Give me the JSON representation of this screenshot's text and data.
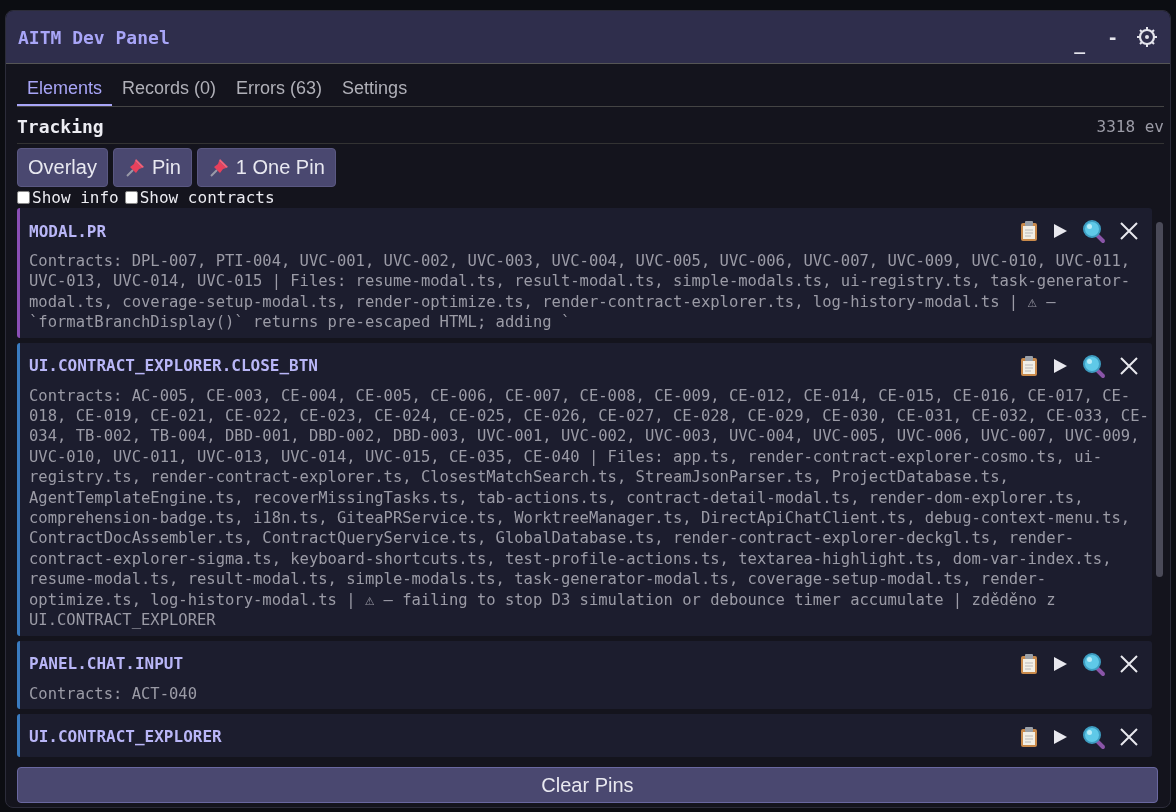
{
  "window": {
    "title": "AITM Dev Panel",
    "controls": [
      "_",
      "-"
    ]
  },
  "tabs": [
    {
      "label": "Elements",
      "selected": true
    },
    {
      "label": "Records (0)",
      "selected": false
    },
    {
      "label": "Errors (63)",
      "selected": false
    },
    {
      "label": "Settings",
      "selected": false
    }
  ],
  "tracking": {
    "label": "Tracking",
    "count": "3318 ev"
  },
  "buttons": [
    {
      "label": "Overlay",
      "kind": "plain"
    },
    {
      "label": "Pin",
      "kind": "pin"
    },
    {
      "label": "1 One Pin",
      "kind": "pin"
    }
  ],
  "checkboxes": [
    {
      "label": "Show info",
      "checked": false
    },
    {
      "label": "Show contracts",
      "checked": false
    }
  ],
  "pins": [
    {
      "name": "MODAL.PR",
      "color": "#8a4fb5",
      "details": "Contracts: DPL-007, PTI-004, UVC-001, UVC-002, UVC-003, UVC-004, UVC-005, UVC-006, UVC-007, UVC-009, UVC-010, UVC-011, UVC-013, UVC-014, UVC-015 | Files: resume-modal.ts, result-modal.ts, simple-modals.ts, ui-registry.ts, task-generator-modal.ts, coverage-setup-modal.ts, render-optimize.ts, render-contract-explorer.ts, log-history-modal.ts | ⚠ — `formatBranchDisplay()` returns pre-escaped HTML; adding `"
    },
    {
      "name": "UI.CONTRACT_EXPLORER.CLOSE_BTN",
      "color": "#3a7bbf",
      "details": "Contracts: AC-005, CE-003, CE-004, CE-005, CE-006, CE-007, CE-008, CE-009, CE-012, CE-014, CE-015, CE-016, CE-017, CE-018, CE-019, CE-021, CE-022, CE-023, CE-024, CE-025, CE-026, CE-027, CE-028, CE-029, CE-030, CE-031, CE-032, CE-033, CE-034, TB-002, TB-004, DBD-001, DBD-002, DBD-003, UVC-001, UVC-002, UVC-003, UVC-004, UVC-005, UVC-006, UVC-007, UVC-009, UVC-010, UVC-011, UVC-013, UVC-014, UVC-015, CE-035, CE-040 | Files: app.ts, render-contract-explorer-cosmo.ts, ui-registry.ts, render-contract-explorer.ts, ClosestMatchSearch.ts, StreamJsonParser.ts, ProjectDatabase.ts, AgentTemplateEngine.ts, recoverMissingTasks.ts, tab-actions.ts, contract-detail-modal.ts, render-dom-explorer.ts, comprehension-badge.ts, i18n.ts, GiteaPRService.ts, WorktreeManager.ts, DirectApiChatClient.ts, debug-context-menu.ts, ContractDocAssembler.ts, ContractQueryService.ts, GlobalDatabase.ts, render-contract-explorer-deckgl.ts, render-contract-explorer-sigma.ts, keyboard-shortcuts.ts, test-profile-actions.ts, textarea-highlight.ts, dom-var-index.ts, resume-modal.ts, result-modal.ts, simple-modals.ts, task-generator-modal.ts, coverage-setup-modal.ts, render-optimize.ts, log-history-modal.ts | ⚠ — failing to stop D3 simulation or debounce timer accumulate | zděděno z UI.CONTRACT_EXPLORER"
    },
    {
      "name": "PANEL.CHAT.INPUT",
      "color": "#3a7bbf",
      "details": "Contracts: ACT-040"
    },
    {
      "name": "UI.CONTRACT_EXPLORER",
      "color": "#3a7bbf"
    }
  ],
  "footer_button": "Clear Pins"
}
